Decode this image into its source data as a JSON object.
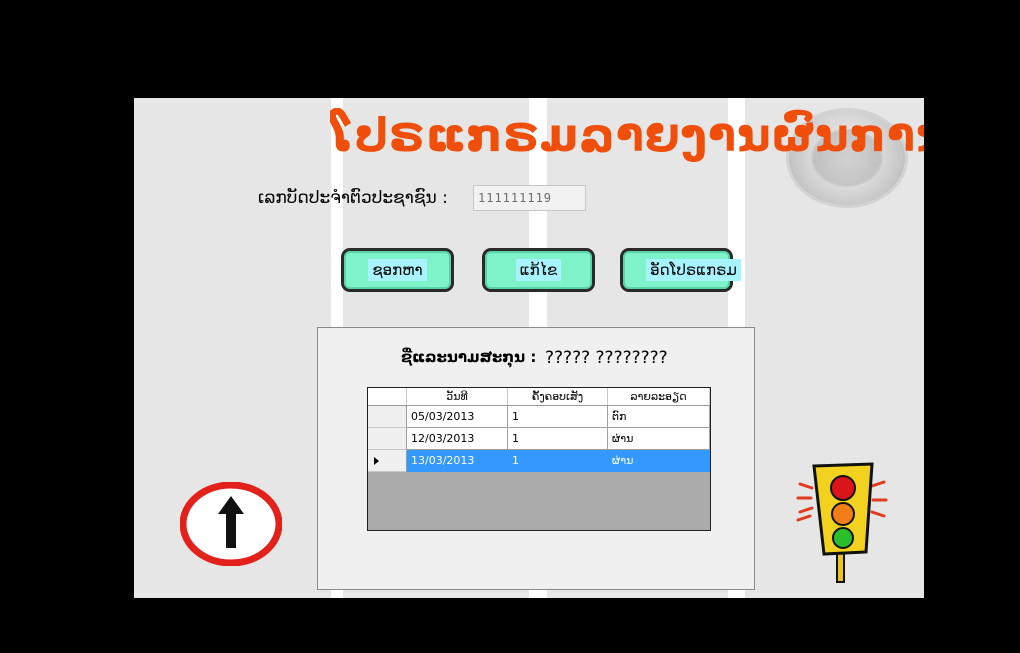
{
  "app": {
    "title": "ໂປຣແກຣມລາຍງານຜົນການ"
  },
  "form": {
    "id_label": "ເລກບັດປະຈໍາຕົວປະຊາຊົນ :",
    "id_value": "111111119"
  },
  "buttons": {
    "search": "ຊອກຫາ",
    "edit": "ແກ້ໄຂ",
    "close": "ອັດໂປຣແກຣມ"
  },
  "result": {
    "label": "ຊື່ແລະນາມສະກຸນ :",
    "value": "????? ????????"
  },
  "table": {
    "columns": [
      "ວັນທີ",
      "ຄັ້ງຄອບເສັງ",
      "ລາຍລະອຽດ"
    ],
    "rows": [
      {
        "date": "05/03/2013",
        "attempt": "1",
        "detail": "ຕົກ",
        "selected": false
      },
      {
        "date": "12/03/2013",
        "attempt": "1",
        "detail": "ຜ່ານ",
        "selected": false
      },
      {
        "date": "13/03/2013",
        "attempt": "1",
        "detail": "ຜ່ານ",
        "selected": true
      }
    ]
  },
  "colors": {
    "title": "#f04e0b",
    "button_fill": "#7ef2c9",
    "selection": "#3399ff"
  },
  "icons": [
    "logo-emblem",
    "arrow-up-sign-icon",
    "traffic-light-icon"
  ]
}
